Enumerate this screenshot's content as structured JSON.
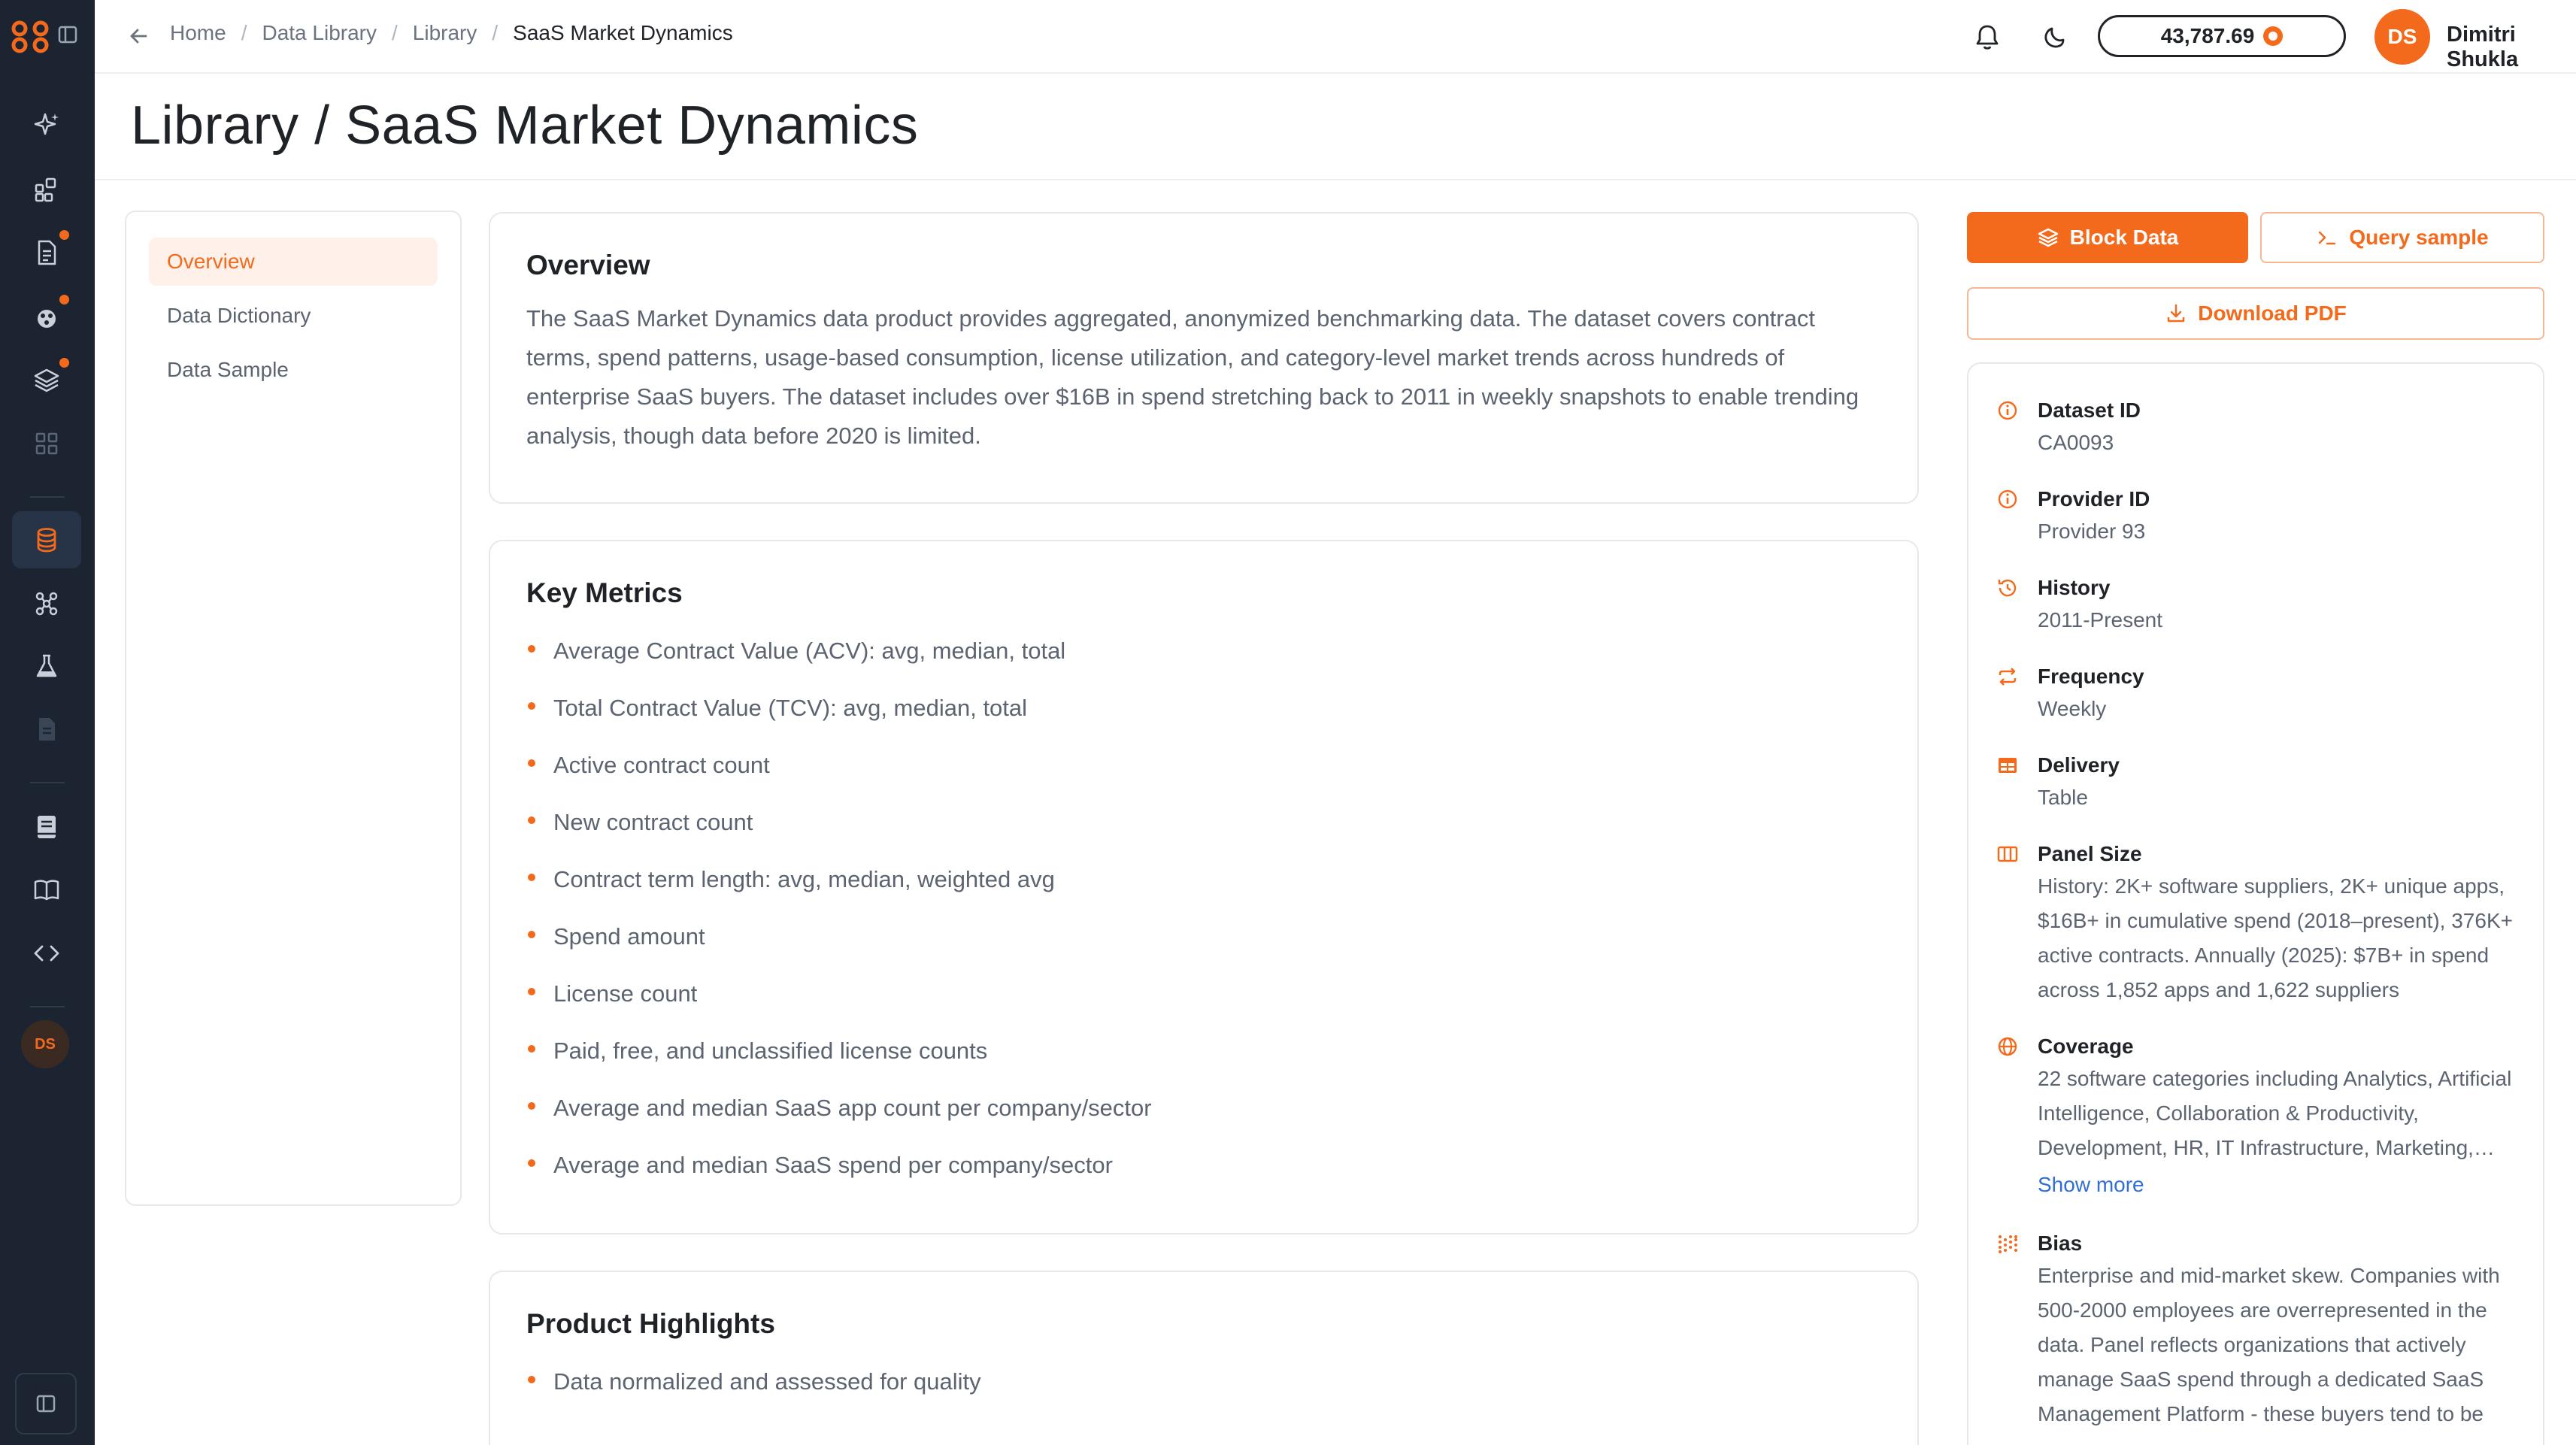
{
  "breadcrumb": [
    "Home",
    "Data Library",
    "Library",
    "SaaS Market Dynamics"
  ],
  "header": {
    "credits": "43,787.69",
    "user_initials": "DS",
    "user_name": "Dimitri Shukla"
  },
  "rail": {
    "avatar_initials": "DS"
  },
  "page_title": "Library / SaaS Market Dynamics",
  "section_nav": [
    "Overview",
    "Data Dictionary",
    "Data Sample"
  ],
  "overview": {
    "title": "Overview",
    "text": "The SaaS Market Dynamics data product provides aggregated, anonymized benchmarking data. The dataset covers contract terms, spend patterns, usage-based consumption, license utilization, and category-level market trends across hundreds of enterprise SaaS buyers. The dataset includes over $16B in spend stretching back to 2011 in weekly snapshots to enable trending analysis, though data before 2020 is limited."
  },
  "key_metrics": {
    "title": "Key Metrics",
    "items": [
      "Average Contract Value (ACV): avg, median, total",
      "Total Contract Value (TCV): avg, median, total",
      "Active contract count",
      "New contract count",
      "Contract term length: avg, median, weighted avg",
      "Spend amount",
      "License count",
      "Paid, free, and unclassified license counts",
      "Average and median SaaS app count per company/sector",
      "Average and median SaaS spend per company/sector"
    ]
  },
  "highlights": {
    "title": "Product Highlights",
    "items": [
      "Data normalized and assessed for quality"
    ]
  },
  "actions": {
    "block_data": "Block Data",
    "query_sample": "Query sample",
    "download_pdf": "Download PDF"
  },
  "meta": {
    "dataset_id": {
      "label": "Dataset ID",
      "value": "CA0093"
    },
    "provider_id": {
      "label": "Provider ID",
      "value": "Provider 93"
    },
    "history": {
      "label": "History",
      "value": "2011-Present"
    },
    "frequency": {
      "label": "Frequency",
      "value": "Weekly"
    },
    "delivery": {
      "label": "Delivery",
      "value": "Table"
    },
    "panel_size": {
      "label": "Panel Size",
      "value": "History: 2K+ software suppliers, 2K+ unique apps, $16B+ in cumulative spend (2018–present), 376K+ active contracts. Annually (2025): $7B+ in spend across 1,852 apps and 1,622 suppliers"
    },
    "coverage": {
      "label": "Coverage",
      "value": "22 software categories including Analytics, Artificial Intelligence, Collaboration & Productivity, Development, HR, IT Infrastructure, Marketing,…",
      "show_more": "Show more"
    },
    "bias": {
      "label": "Bias",
      "value": "Enterprise and mid-market skew. Companies with 500-2000 employees are overrepresented in the data. Panel reflects organizations that actively manage SaaS spend through a dedicated SaaS Management Platform - these buyers tend to be"
    }
  },
  "colors": {
    "accent": "#f36a1d",
    "rail": "#1c2431",
    "link": "#2f6fd6"
  }
}
